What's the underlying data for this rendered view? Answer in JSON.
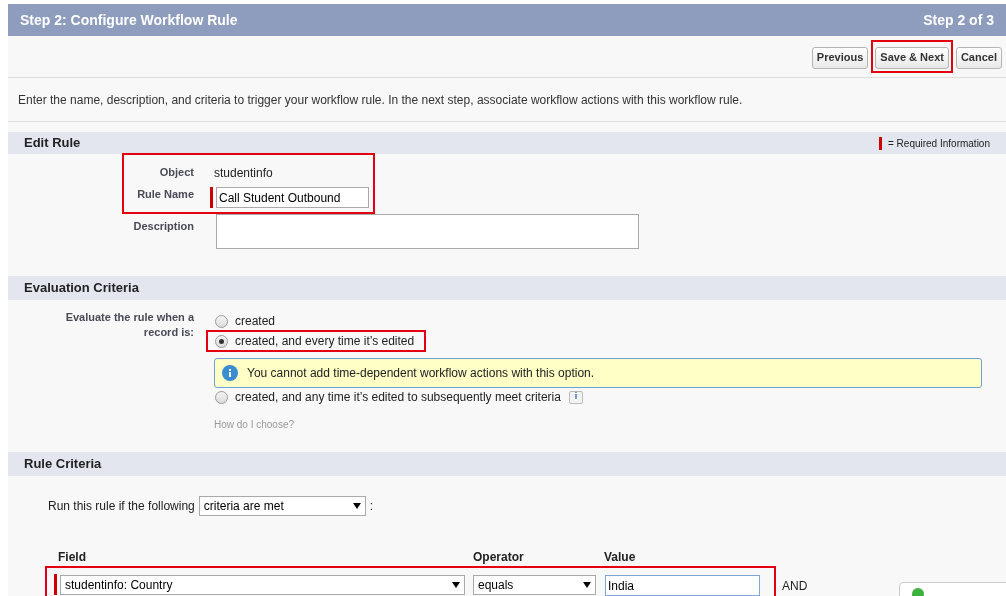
{
  "header": {
    "title": "Step 2: Configure Workflow Rule",
    "step": "Step 2 of 3"
  },
  "buttons": [
    {
      "label": "Previous",
      "highlighted": false
    },
    {
      "label": "Save & Next",
      "highlighted": true
    },
    {
      "label": "Cancel",
      "highlighted": false
    }
  ],
  "intro": "Enter the name, description, and criteria to trigger your workflow rule. In the next step, associate workflow actions with this workflow rule.",
  "edit_rule": {
    "title": "Edit Rule",
    "required_legend": "= Required Information",
    "object_label": "Object",
    "object_value": "studentinfo",
    "rule_name_label": "Rule Name",
    "rule_name_value": "Call Student Outbound",
    "description_label": "Description"
  },
  "evaluation": {
    "title": "Evaluation Criteria",
    "label": "Evaluate the rule when a record is:",
    "options": [
      {
        "label": "created",
        "selected": false,
        "highlighted": false
      },
      {
        "label": "created, and every time it’s edited",
        "selected": true,
        "highlighted": true
      },
      {
        "label": "created, and any time it’s edited to subsequently meet criteria",
        "selected": false,
        "highlighted": false,
        "info": "i"
      }
    ],
    "notice": "You cannot add time-dependent workflow actions with this option.",
    "help_link": "How do I choose?"
  },
  "rule_criteria": {
    "title": "Rule Criteria",
    "run_label": "Run this rule if the following",
    "run_value": "criteria are met",
    "run_suffix": ":",
    "columns": [
      "Field",
      "Operator",
      "Value"
    ],
    "rows": [
      {
        "field": "studentinfo: Country",
        "operator": "equals",
        "value": "India",
        "conjunction": "AND"
      }
    ]
  }
}
